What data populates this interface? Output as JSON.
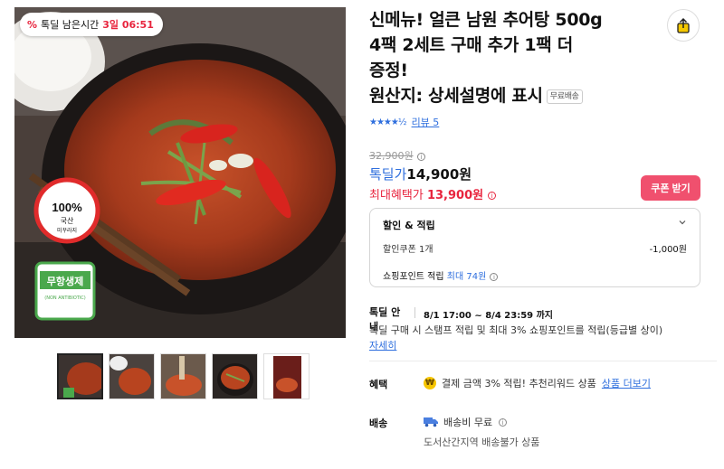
{
  "deal_badge": {
    "icon": "percent-icon",
    "label": "톡딜 남은시간",
    "time": "3일 06:51"
  },
  "image_overlay": {
    "cert_percent": "100%",
    "cert_line1": "국산",
    "cert_line2": "미꾸라지",
    "antibiotic_title": "무항생제",
    "antibiotic_sub": "(NON ANTIBIOTIC)"
  },
  "product": {
    "title_lines": [
      "신메뉴! 얼큰 남원 추어탕 500g",
      "4팩 2세트 구매 추가 1팩 더",
      "증정!",
      "원산지: 상세설명에 표시"
    ],
    "free_shipping_tag": "무료배송",
    "rating": 4.5,
    "stars": "★★★★½",
    "review_label": "리뷰 5"
  },
  "pricing": {
    "original": "32,900원",
    "deal_label": "톡딜가",
    "deal_price": "14,900원",
    "max_benefit_label": "최대혜택가",
    "max_benefit_price": "13,900원",
    "coupon_button": "쿠폰 받기"
  },
  "discount": {
    "header": "할인 & 적립",
    "coupon_label": "할인쿠폰 1개",
    "coupon_amount": "-1,000원",
    "point_label": "쇼핑포인트 적립",
    "point_value": "최대 74원"
  },
  "notice": {
    "label": "톡딜 안내",
    "period": "8/1 17:00 ~ 8/4 23:59 까지",
    "description": "톡딜 구매 시 스탬프 적립 및 최대 3% 쇼핑포인트를 적립(등급별 상이)",
    "more_link": "자세히"
  },
  "benefit": {
    "label": "혜택",
    "icon": "won-coin-icon",
    "text": "결제 금액 3% 적립! 추천리워드 상품",
    "more_link": "상품 더보기"
  },
  "shipping": {
    "label": "배송",
    "icon": "truck-icon",
    "text": "배송비 무료",
    "note": "도서산간지역 배송불가 상품"
  },
  "colors": {
    "accent_blue": "#2f6fde",
    "accent_red": "#e8253e",
    "coupon_pink": "#f0506e"
  }
}
